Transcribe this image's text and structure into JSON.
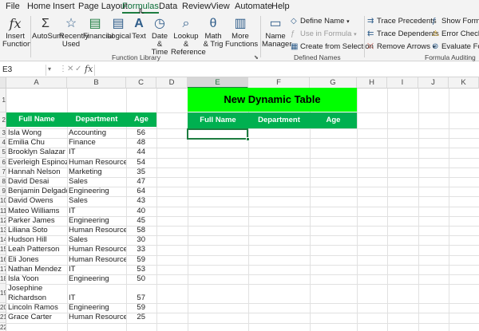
{
  "menu": {
    "tabs": [
      "File",
      "Home",
      "Insert",
      "Page Layout",
      "Formulas",
      "Data",
      "Review",
      "View",
      "Automate",
      "Help"
    ],
    "active_tab": "Formulas"
  },
  "ribbon": {
    "insert_function": "Insert Function",
    "autosum": "AutoSum",
    "recently_used": "Recently Used",
    "financial": "Financial",
    "logical": "Logical",
    "text": "Text",
    "date_time": "Date & Time",
    "lookup_reference": "Lookup & Reference",
    "math_trig": "Math & Trig",
    "more_functions": "More Functions",
    "name_manager": "Name Manager",
    "define_name": "Define Name",
    "use_in_formula": "Use in Formula",
    "create_from_selection": "Create from Selection",
    "trace_precedents": "Trace Precedents",
    "trace_dependents": "Trace Dependents",
    "remove_arrows": "Remove Arrows",
    "show_formulas": "Show Formulas",
    "error_checking": "Error Checking",
    "evaluate_formula": "Evaluate Formula",
    "group_function_library": "Function Library",
    "group_defined_names": "Defined Names",
    "group_formula_auditing": "Formula Auditing"
  },
  "formula_bar": {
    "name_box": "E3",
    "fx": "fx",
    "value": ""
  },
  "grid": {
    "columns": [
      "A",
      "B",
      "C",
      "D",
      "E",
      "F",
      "G",
      "H",
      "I",
      "J",
      "K"
    ],
    "row_numbers": [
      "1",
      "2",
      "3",
      "4",
      "5",
      "6",
      "7",
      "8",
      "9",
      "10",
      "11",
      "12",
      "13",
      "14",
      "15",
      "16",
      "17",
      "18",
      "19",
      "20",
      "21",
      "22"
    ],
    "table_headers": [
      "Full Name",
      "Department",
      "Age"
    ],
    "rows": [
      {
        "name": "Isla Wong",
        "dept": "Accounting",
        "age": "56"
      },
      {
        "name": "Emilia Chu",
        "dept": "Finance",
        "age": "48"
      },
      {
        "name": "Brooklyn Salazar",
        "dept": "IT",
        "age": "44"
      },
      {
        "name": "Everleigh Espinoza",
        "dept": "Human Resources",
        "age": "54"
      },
      {
        "name": "Hannah Nelson",
        "dept": "Marketing",
        "age": "35"
      },
      {
        "name": "David Desai",
        "dept": "Sales",
        "age": "47"
      },
      {
        "name": "Benjamin Delgado",
        "dept": "Engineering",
        "age": "64"
      },
      {
        "name": "David Owens",
        "dept": "Sales",
        "age": "43"
      },
      {
        "name": "Mateo Williams",
        "dept": "IT",
        "age": "40"
      },
      {
        "name": "Parker James",
        "dept": "Engineering",
        "age": "45"
      },
      {
        "name": "Liliana Soto",
        "dept": "Human Resources",
        "age": "58"
      },
      {
        "name": "Hudson Hill",
        "dept": "Sales",
        "age": "30"
      },
      {
        "name": "Leah Patterson",
        "dept": "Human Resources",
        "age": "33"
      },
      {
        "name": "Eli Jones",
        "dept": "Human Resources",
        "age": "59"
      },
      {
        "name": "Nathan Mendez",
        "dept": "IT",
        "age": "53"
      },
      {
        "name": "Isla Yoon",
        "dept": "Engineering",
        "age": "50"
      },
      {
        "name": "Josephine Richardson",
        "dept": "IT",
        "age": "57"
      },
      {
        "name": "Lincoln Ramos",
        "dept": "Engineering",
        "age": "59"
      },
      {
        "name": "Grace Carter",
        "dept": "Human Resources",
        "age": "25"
      }
    ],
    "dynamic_title": "New Dynamic Table",
    "dynamic_headers": [
      "Full Name",
      "Department",
      "Age"
    ]
  },
  "colors": {
    "header_green": "#00b050",
    "title_green": "#00ff00",
    "accent": "#1e7d41"
  }
}
